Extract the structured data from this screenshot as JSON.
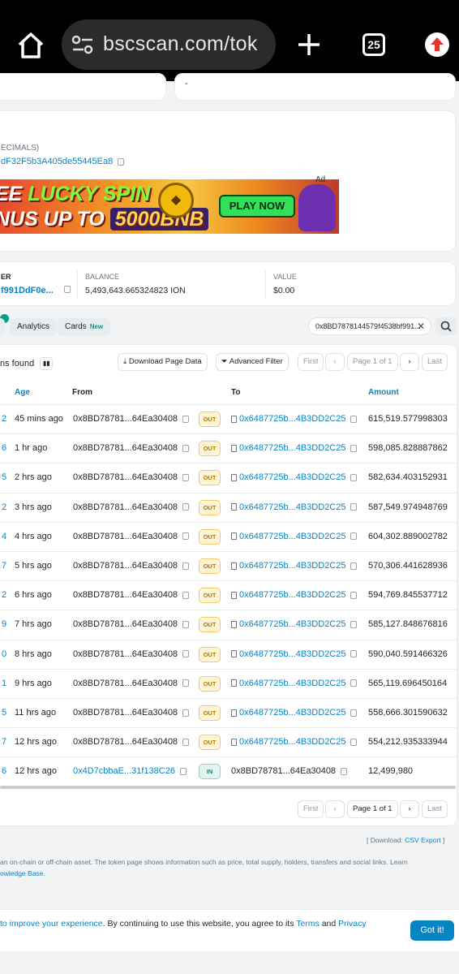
{
  "browser": {
    "url": "bscscan.com/tok",
    "tab_count": "25"
  },
  "top_card": {
    "dash": "-"
  },
  "contract_card": {
    "label": "ECIMALS)",
    "address": "dF32F5b3A405de55445Ea8",
    "ad": {
      "line1_a": "EE ",
      "line1_b": "LUCKY SPIN",
      "line2_a": "NUS UP TO ",
      "line2_b": "5000BNB",
      "cta": "PLAY NOW",
      "tag": "Ad"
    }
  },
  "summary": {
    "holder_label": "ER",
    "holder_value": "f991DdF0e...",
    "balance_label": "BALANCE",
    "balance_value": "5,493,643.665324823 ION",
    "value_label": "VALUE",
    "value_value": "$0.00"
  },
  "tabs": {
    "analytics": "Analytics",
    "cards": "Cards",
    "cards_badge": "New"
  },
  "filter_address": "0x8BD7878144579f4538bf991...",
  "toolbar": {
    "found_text": "ns found",
    "download": "Download Page Data",
    "advanced_filter": "Advanced Filter",
    "first": "First",
    "page": "Page 1 of 1",
    "last": "Last"
  },
  "table": {
    "headers": {
      "age": "Age",
      "from": "From",
      "to": "To",
      "amount": "Amount"
    },
    "rows": [
      {
        "idx": "2",
        "age": "45 mins ago",
        "from": "0x8BD78781...64Ea30408",
        "dir": "OUT",
        "to": "0x6487725b...4B3DD2C25",
        "amount": "615,519.577998303"
      },
      {
        "idx": "6",
        "age": "1 hr ago",
        "from": "0x8BD78781...64Ea30408",
        "dir": "OUT",
        "to": "0x6487725b...4B3DD2C25",
        "amount": "598,085.828887862"
      },
      {
        "idx": "5",
        "age": "2 hrs ago",
        "from": "0x8BD78781...64Ea30408",
        "dir": "OUT",
        "to": "0x6487725b...4B3DD2C25",
        "amount": "582,634.403152931"
      },
      {
        "idx": "2",
        "age": "3 hrs ago",
        "from": "0x8BD78781...64Ea30408",
        "dir": "OUT",
        "to": "0x6487725b...4B3DD2C25",
        "amount": "587,549.974948769"
      },
      {
        "idx": "4",
        "age": "4 hrs ago",
        "from": "0x8BD78781...64Ea30408",
        "dir": "OUT",
        "to": "0x6487725b...4B3DD2C25",
        "amount": "604,302.889002782"
      },
      {
        "idx": "7",
        "age": "5 hrs ago",
        "from": "0x8BD78781...64Ea30408",
        "dir": "OUT",
        "to": "0x6487725b...4B3DD2C25",
        "amount": "570,306.441628936"
      },
      {
        "idx": "2",
        "age": "6 hrs ago",
        "from": "0x8BD78781...64Ea30408",
        "dir": "OUT",
        "to": "0x6487725b...4B3DD2C25",
        "amount": "594,769.845537712"
      },
      {
        "idx": "9",
        "age": "7 hrs ago",
        "from": "0x8BD78781...64Ea30408",
        "dir": "OUT",
        "to": "0x6487725b...4B3DD2C25",
        "amount": "585,127.848676816"
      },
      {
        "idx": "0",
        "age": "8 hrs ago",
        "from": "0x8BD78781...64Ea30408",
        "dir": "OUT",
        "to": "0x6487725b...4B3DD2C25",
        "amount": "590,040.591466326"
      },
      {
        "idx": "1",
        "age": "9 hrs ago",
        "from": "0x8BD78781...64Ea30408",
        "dir": "OUT",
        "to": "0x6487725b...4B3DD2C25",
        "amount": "565,119.696450164"
      },
      {
        "idx": "5",
        "age": "11 hrs ago",
        "from": "0x8BD78781...64Ea30408",
        "dir": "OUT",
        "to": "0x6487725b...4B3DD2C25",
        "amount": "558,666.301590632"
      },
      {
        "idx": "7",
        "age": "12 hrs ago",
        "from": "0x8BD78781...64Ea30408",
        "dir": "OUT",
        "to": "0x6487725b...4B3DD2C25",
        "amount": "554,212.935333944"
      },
      {
        "idx": "6",
        "age": "12 hrs ago",
        "from": "0x4D7cbbaE...31f138C26",
        "dir": "IN",
        "to": "0x8BD78781...64Ea30408",
        "amount": "12,499,980"
      }
    ]
  },
  "pager_bottom": {
    "first": "First",
    "page": "Page 1 of 1",
    "last": "Last"
  },
  "download_note": {
    "prefix": "[ Download: ",
    "link": "CSV Export",
    "suffix": " ]"
  },
  "footer": {
    "desc": "an on-chain or off-chain asset. The token page shows information such as price, total supply, holders, transfers and social links. Learn",
    "kb_link": "owledge Base",
    "kb_suffix": "."
  },
  "cookie": {
    "link1": "to improve your experience",
    "text1": ". By continuing to use this website, you agree to its ",
    "terms": "Terms",
    "and": " and ",
    "privacy": "Privacy",
    "button": "Got it!"
  }
}
